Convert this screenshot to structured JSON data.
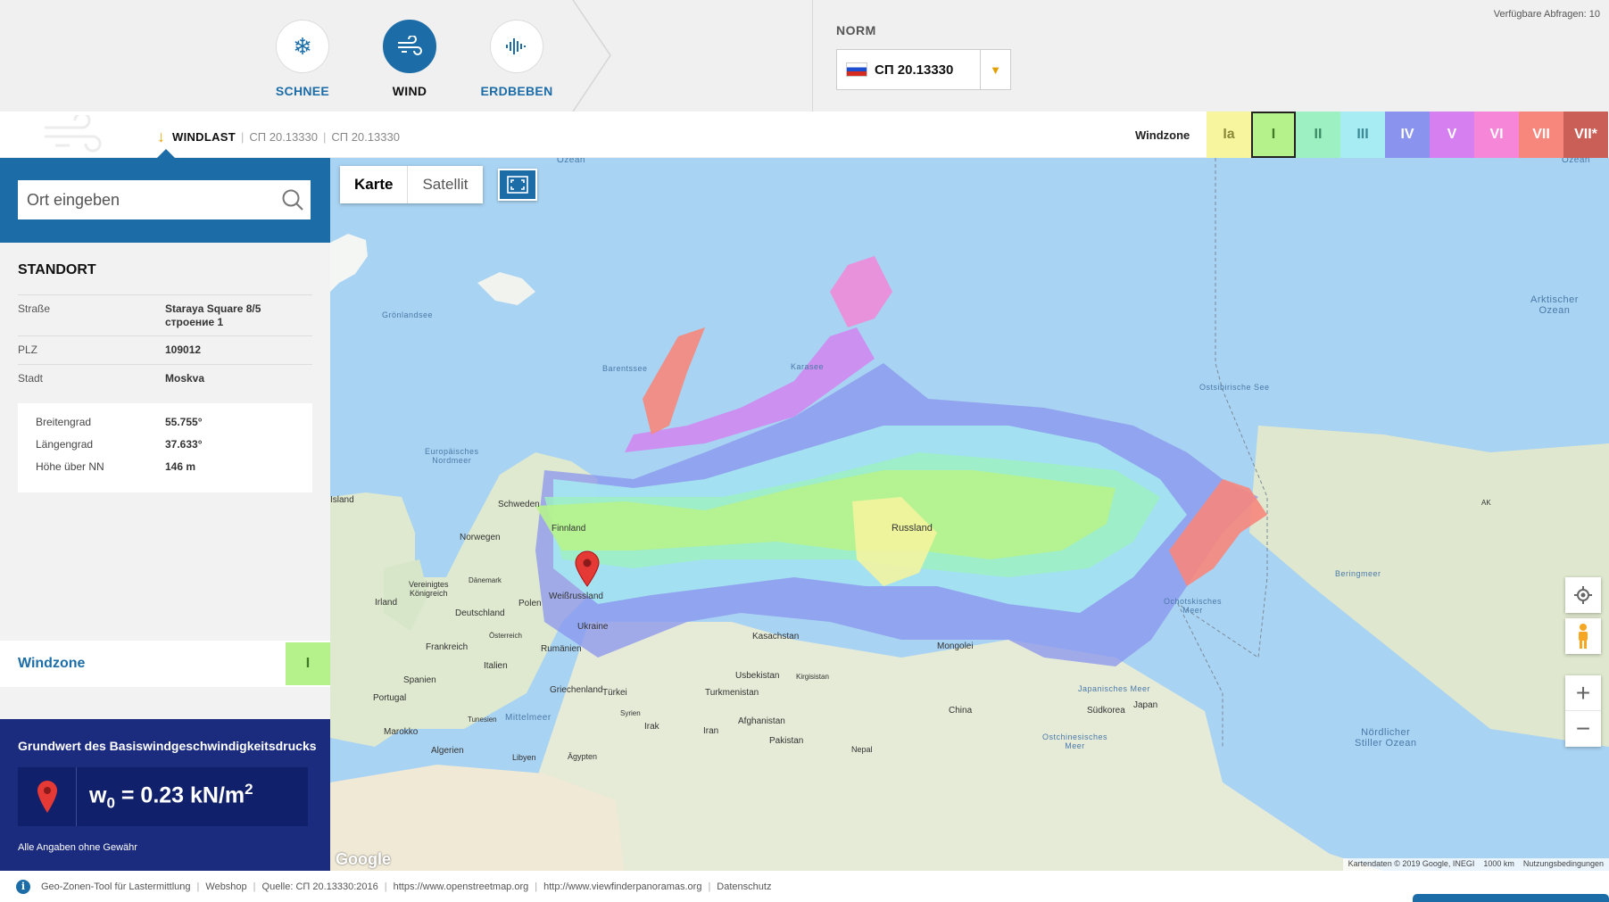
{
  "header": {
    "modes": [
      {
        "label": "SCHNEE",
        "icon": "snowflake-icon",
        "active": false
      },
      {
        "label": "WIND",
        "icon": "wind-icon",
        "active": true
      },
      {
        "label": "ERDBEBEN",
        "icon": "seismograph-icon",
        "active": false
      }
    ],
    "norm_label": "NORM",
    "norm_value": "СП 20.13330",
    "queries": "Verfügbare Abfragen: 10"
  },
  "subheader": {
    "crumb_current": "WINDLAST",
    "crumb_1": "СП 20.13330",
    "crumb_2": "СП 20.13330",
    "windzone_label": "Windzone",
    "zones": [
      {
        "label": "Ia",
        "color": "#f7f59e",
        "text": "#8a8a3a"
      },
      {
        "label": "I",
        "color": "#b6f28c",
        "text": "#3f7b25",
        "selected": true
      },
      {
        "label": "II",
        "color": "#9df0c2",
        "text": "#3a8a66"
      },
      {
        "label": "III",
        "color": "#a6ecf2",
        "text": "#3b8a96"
      },
      {
        "label": "IV",
        "color": "#8a94ee",
        "text": "#ffffff"
      },
      {
        "label": "V",
        "color": "#d57ff0",
        "text": "#ffffff"
      },
      {
        "label": "VI",
        "color": "#f586d8",
        "text": "#ffffff"
      },
      {
        "label": "VII",
        "color": "#f7867c",
        "text": "#ffffff"
      },
      {
        "label": "VII*",
        "color": "#c95f57",
        "text": "#ffffff"
      }
    ]
  },
  "search": {
    "placeholder": "Ort eingeben"
  },
  "standort": {
    "title": "STANDORT",
    "street_label": "Straße",
    "street_value_1": "Staraya Square 8/5",
    "street_value_2": "строение 1",
    "plz_label": "PLZ",
    "plz_value": "109012",
    "city_label": "Stadt",
    "city_value": "Moskva",
    "lat_label": "Breitengrad",
    "lat_value": "55.755°",
    "lon_label": "Längengrad",
    "lon_value": "37.633°",
    "alt_label": "Höhe über NN",
    "alt_value": "146 m"
  },
  "windzone": {
    "label": "Windzone",
    "value": "I"
  },
  "result": {
    "heading": "Grundwert des Basiswindgeschwindigkeitsdrucks",
    "symbol": "w",
    "subscript": "0",
    "value": " = 0.23 kN/m",
    "exponent": "2",
    "disclaimer": "Alle Angaben ohne Gewähr"
  },
  "map": {
    "type_map": "Karte",
    "type_satellite": "Satellit",
    "labels": {
      "ozean_top": "Ozean",
      "ozean_right": "Ozean",
      "groenlandsee": "Grönlandsee",
      "barentssee": "Barentssee",
      "karasee": "Karasee",
      "ostsibirische_see": "Ostsibirische See",
      "arktischer_ozean": "Arktischer",
      "arktischer_ozean_2": "Ozean",
      "europ_nordmeer": "Europäisches",
      "europ_nordmeer_2": "Nordmeer",
      "island": "Island",
      "schweden": "Schweden",
      "finnland": "Finnland",
      "norwegen": "Norwegen",
      "vk": "Vereinigtes",
      "vk_2": "Königreich",
      "daenemark": "Dänemark",
      "irland": "Irland",
      "deutschland": "Deutschland",
      "polen": "Polen",
      "weissrussland": "Weißrussland",
      "ukraine": "Ukraine",
      "frankreich": "Frankreich",
      "oesterreich": "Österreich",
      "rumaenien": "Rumänien",
      "spanien": "Spanien",
      "italien": "Italien",
      "portugal": "Portugal",
      "griechenland": "Griechenland",
      "tuerkei": "Türkei",
      "marokko": "Marokko",
      "tunesien": "Tunesien",
      "algerien": "Algerien",
      "aegypten": "Ägypten",
      "libyen": "Libyen",
      "syrien": "Syrien",
      "irak": "Irak",
      "iran": "Iran",
      "mittelmeer": "Mittelmeer",
      "russland": "Russland",
      "kasachstan": "Kasachstan",
      "usbekistan": "Usbekistan",
      "kirgisistan": "Kirgisistan",
      "turkmenistan": "Turkmenistan",
      "afghanistan": "Afghanistan",
      "pakistan": "Pakistan",
      "nepal": "Nepal",
      "mongolei": "Mongolei",
      "china": "China",
      "suedkorea": "Südkorea",
      "japan": "Japan",
      "japanisches_meer": "Japanisches Meer",
      "ochotskisches": "Ochotskisches",
      "ochotskisches_2": "Meer",
      "beringmeer": "Beringmeer",
      "ostchinesisches": "Ostchinesisches",
      "ostchinesisches_2": "Meer",
      "noerdlicher": "Nördlicher",
      "stiller_ozean": "Stiller Ozean",
      "ak": "AK"
    },
    "google": "Google",
    "attribution": "Kartendaten © 2019 Google, INEGI",
    "scale": "1000 km",
    "terms": "Nutzungsbedingungen"
  },
  "footer": {
    "items": [
      "Geo-Zonen-Tool für Lastermittlung",
      "Webshop",
      "Quelle: СП 20.13330:2016",
      "https://www.openstreetmap.org",
      "http://www.viewfinderpanoramas.org",
      "Datenschutz"
    ]
  }
}
